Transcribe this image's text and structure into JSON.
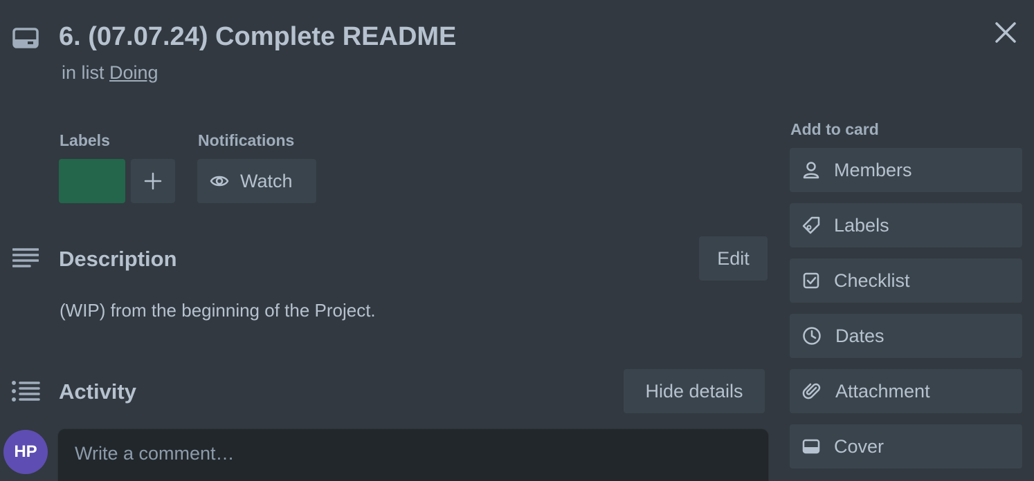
{
  "card": {
    "title": "6. (07.07.24) Complete README",
    "list_prefix": "in list",
    "list_name": "Doing"
  },
  "labels_section": {
    "heading": "Labels",
    "label_color": "#216e4e"
  },
  "notifications_section": {
    "heading": "Notifications",
    "watch_label": "Watch"
  },
  "description": {
    "heading": "Description",
    "edit_label": "Edit",
    "text": "(WIP) from the beginning of the Project."
  },
  "activity": {
    "heading": "Activity",
    "hide_details_label": "Hide details",
    "avatar_initials": "HP",
    "avatar_color": "#5e4db2",
    "comment_placeholder": "Write a comment…"
  },
  "sidebar": {
    "heading": "Add to card",
    "items": [
      {
        "label": "Members",
        "icon": "person-icon"
      },
      {
        "label": "Labels",
        "icon": "tag-icon"
      },
      {
        "label": "Checklist",
        "icon": "checklist-icon"
      },
      {
        "label": "Dates",
        "icon": "clock-icon"
      },
      {
        "label": "Attachment",
        "icon": "paperclip-icon"
      },
      {
        "label": "Cover",
        "icon": "cover-icon"
      }
    ]
  }
}
